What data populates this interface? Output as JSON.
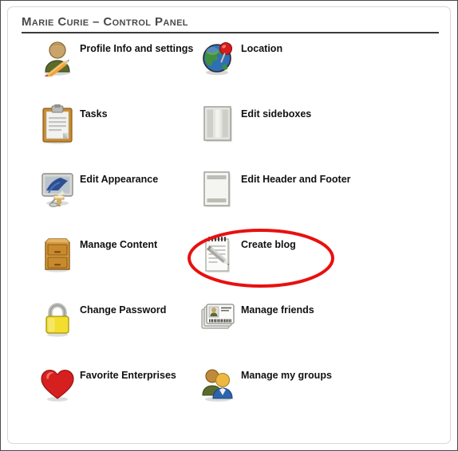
{
  "panel": {
    "title": "Marie Curie – Control Panel",
    "border_color": "#4a4a4a",
    "rule_color": "#3b3b3b"
  },
  "annotation": {
    "shape": "ellipse",
    "color": "#e8100f",
    "target_label": "Create blog"
  },
  "items": [
    {
      "icon": "profile-user-pencil-icon",
      "label": "Profile Info and settings",
      "column": 0,
      "row": 0
    },
    {
      "icon": "globe-pin-location-icon",
      "label": "Location",
      "column": 1,
      "row": 0
    },
    {
      "icon": "clipboard-tasks-icon",
      "label": "Tasks",
      "column": 0,
      "row": 1
    },
    {
      "icon": "sideboxes-columns-icon",
      "label": "Edit sideboxes",
      "column": 1,
      "row": 1
    },
    {
      "icon": "monitor-paintbrush-icon",
      "label": "Edit Appearance",
      "column": 0,
      "row": 2
    },
    {
      "icon": "page-header-footer-icon",
      "label": "Edit Header and Footer",
      "column": 1,
      "row": 2
    },
    {
      "icon": "filing-cabinet-icon",
      "label": "Manage Content",
      "column": 0,
      "row": 3
    },
    {
      "icon": "notepad-pencil-blog-icon",
      "label": "Create blog",
      "column": 1,
      "row": 3
    },
    {
      "icon": "padlock-icon",
      "label": "Change Password",
      "column": 0,
      "row": 4
    },
    {
      "icon": "id-cards-friends-icon",
      "label": "Manage friends",
      "column": 1,
      "row": 4
    },
    {
      "icon": "heart-favorite-icon",
      "label": "Favorite Enterprises",
      "column": 0,
      "row": 5
    },
    {
      "icon": "two-users-groups-icon",
      "label": "Manage my groups",
      "column": 1,
      "row": 5
    }
  ]
}
